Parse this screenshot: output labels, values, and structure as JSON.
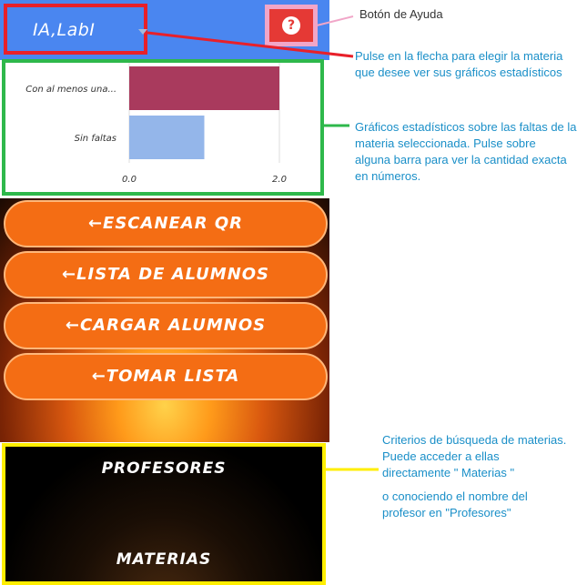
{
  "header": {
    "subject_value": "IA,LabI",
    "help_label": "?"
  },
  "chart_data": {
    "type": "bar",
    "orientation": "horizontal",
    "categories": [
      "Con al menos una...",
      "Sin faltas"
    ],
    "values": [
      2.0,
      1.0
    ],
    "colors": [
      "#a93a5d",
      "#94b6ea"
    ],
    "xlim": [
      0,
      2.0
    ],
    "xticks": [
      "0.0",
      "2.0"
    ],
    "grid": true
  },
  "menu": {
    "scan_qr": "←ESCANEAR QR",
    "student_list": "←LISTA DE ALUMNOS",
    "load_students": "←CARGAR ALUMNOS",
    "take_attendance": "←TOMAR LISTA"
  },
  "criteria": {
    "professors": "PROFESORES",
    "subjects": "MATERIAS"
  },
  "annotations": {
    "help": "Botón de Ayuda",
    "subject_line1": "Pulse en la flecha para elegir la materia",
    "subject_line2": "que desee ver sus gráficos estadísticos",
    "chart_line1": "Gráficos estadísticos sobre las faltas de la",
    "chart_line2": "materia seleccionada. Pulse sobre",
    "chart_line3": "alguna barra para ver la cantidad exacta",
    "chart_line4": "en números.",
    "criteria_line1": "Criterios de búsqueda de materias.",
    "criteria_line2": "Puede acceder a ellas",
    "criteria_line3": "directamente \" Materias \"",
    "criteria_line4": "o conociendo el nombre del",
    "criteria_line5": "profesor en \"Profesores\""
  },
  "colors": {
    "header_blue": "#4a86f0",
    "help_red": "#e53935",
    "menu_orange": "#f46d14",
    "annotation_blue": "#1a8fc8",
    "frame_red": "#e8202a",
    "frame_green": "#2eb84b",
    "frame_yellow": "#ffee00",
    "frame_pink": "#f1a6c8"
  },
  "icons": {
    "help": "question-circle-icon",
    "dropdown": "chevron-down-icon"
  }
}
